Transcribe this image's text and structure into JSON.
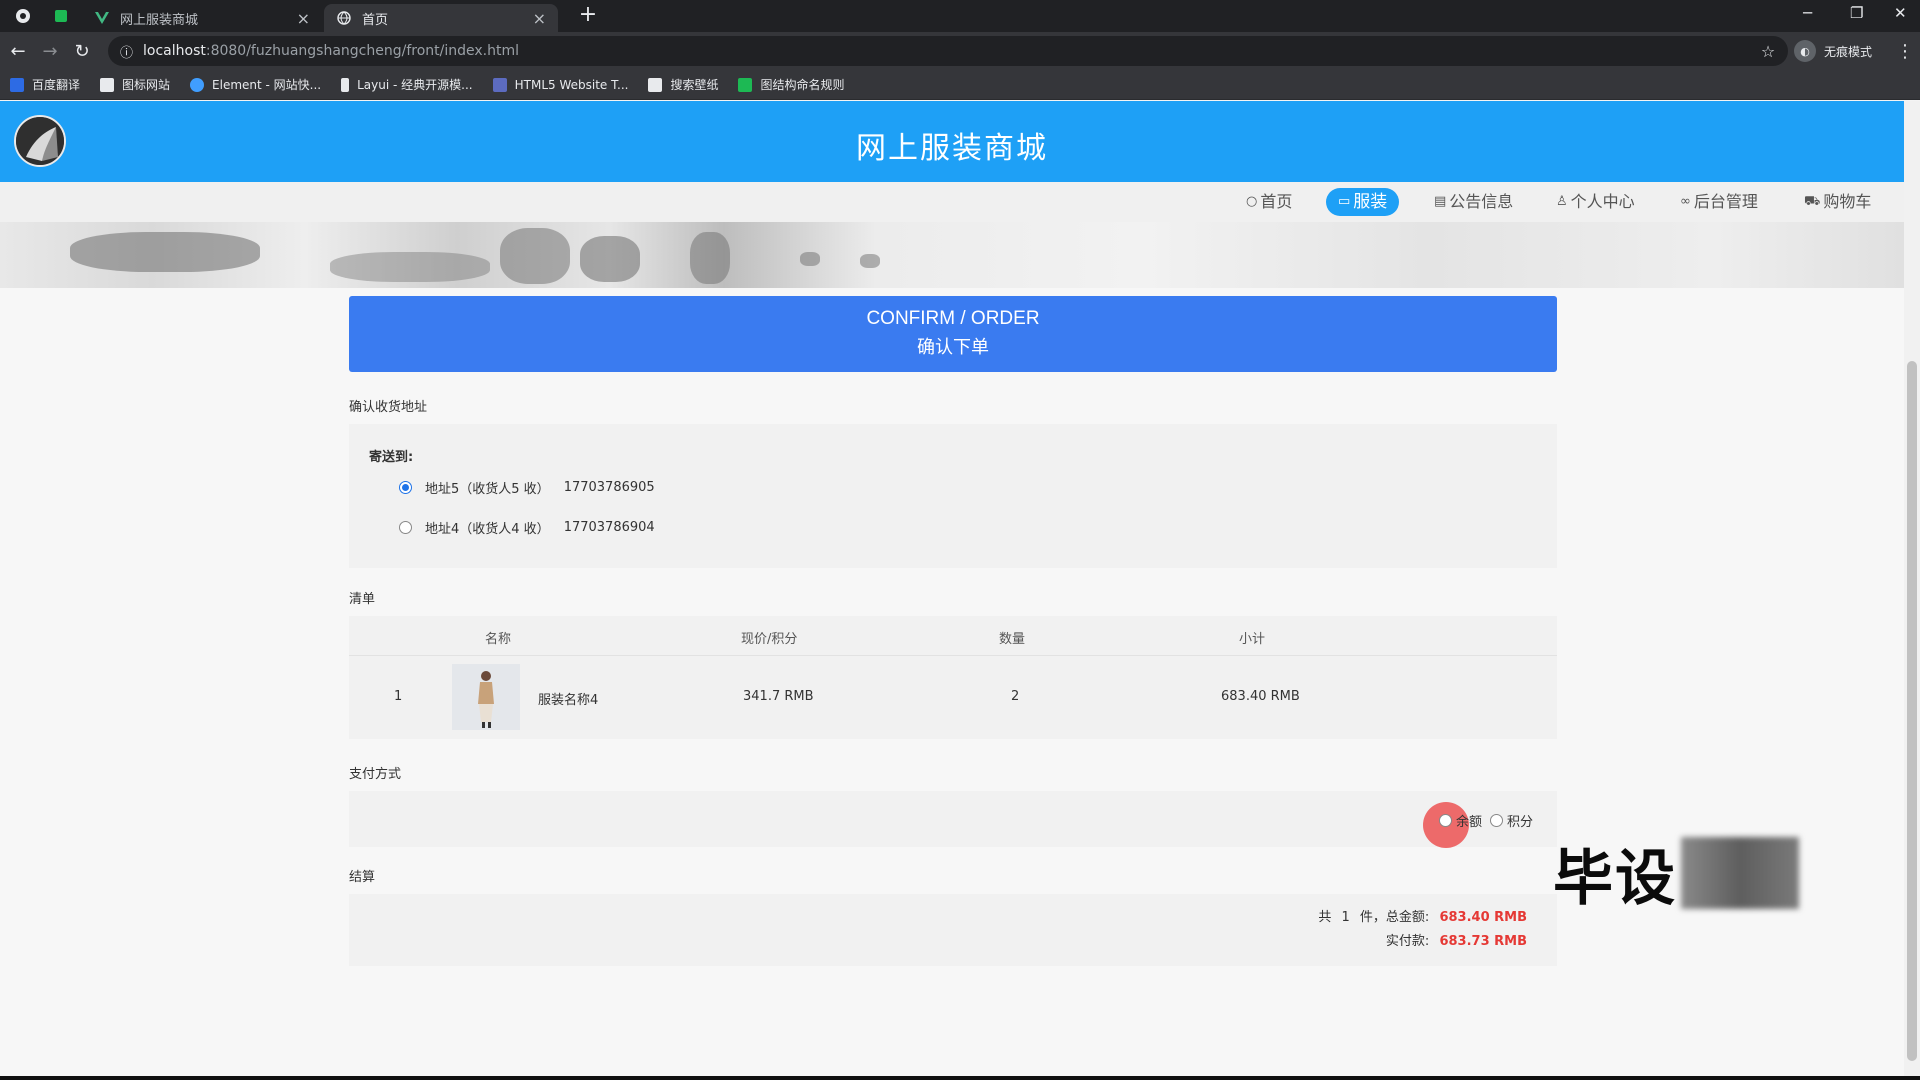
{
  "browser": {
    "tabs": [
      {
        "title": "网上服装商城",
        "active": false
      },
      {
        "title": "首页",
        "active": true
      }
    ],
    "url_host": "localhost",
    "url_rest": ":8080/fuzhuangshangcheng/front/index.html",
    "profile_label": "无痕模式",
    "bookmarks": [
      {
        "label": "百度翻译",
        "color": "#2d6be4"
      },
      {
        "label": "图标网站",
        "color": "#e8eaed"
      },
      {
        "label": "Element - 网站快...",
        "color": "#409eff"
      },
      {
        "label": "Layui - 经典开源模...",
        "color": "#e8eaed"
      },
      {
        "label": "HTML5 Website T...",
        "color": "#5c6bc0"
      },
      {
        "label": "搜索壁纸",
        "color": "#e8eaed"
      },
      {
        "label": "图结构命名规则",
        "color": "#1db954"
      }
    ]
  },
  "site": {
    "title": "网上服装商城",
    "accent_color": "#1ea0f6",
    "nav": [
      {
        "label": "首页",
        "icon": "home-icon",
        "active": false
      },
      {
        "label": "服装",
        "icon": "clothes-icon",
        "active": true
      },
      {
        "label": "公告信息",
        "icon": "notice-icon",
        "active": false
      },
      {
        "label": "个人中心",
        "icon": "user-icon",
        "active": false
      },
      {
        "label": "后台管理",
        "icon": "link-icon",
        "active": false
      },
      {
        "label": "购物车",
        "icon": "cart-icon",
        "active": false
      }
    ]
  },
  "order": {
    "header_en": "CONFIRM / ORDER",
    "header_cn": "确认下单",
    "address_section": "确认收货地址",
    "ship_to": "寄送到:",
    "addresses": [
      {
        "text": "地址5（收货人5 收）",
        "phone": "17703786905",
        "selected": true
      },
      {
        "text": "地址4（收货人4 收）",
        "phone": "17703786904",
        "selected": false
      }
    ],
    "list_section": "清单",
    "columns": [
      "名称",
      "现价/积分",
      "数量",
      "小计"
    ],
    "items": [
      {
        "index": "1",
        "name": "服装名称4",
        "price": "341.7 RMB",
        "qty": "2",
        "subtotal": "683.40 RMB"
      }
    ],
    "payment_section": "支付方式",
    "payment_options": [
      {
        "label": "余额",
        "selected": false
      },
      {
        "label": "积分",
        "selected": false
      }
    ],
    "settle_section": "结算",
    "summary": {
      "prefix": "共",
      "count": "1",
      "suffix": "件，总金额:",
      "total": "683.40 RMB",
      "paid_label": "实付款:",
      "paid": "683.73 RMB"
    }
  },
  "watermark": "毕设"
}
